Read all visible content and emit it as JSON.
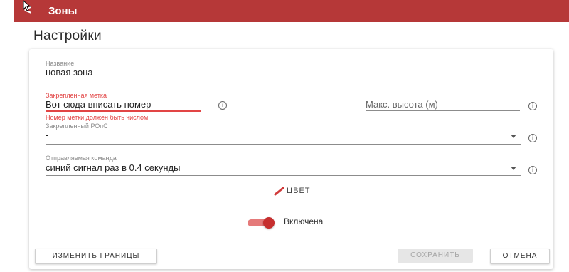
{
  "appbar": {
    "title": "Зоны",
    "back_glyph": "<",
    "color": "#b63838"
  },
  "page": {
    "title": "Настройки"
  },
  "form": {
    "name": {
      "label": "Название",
      "value": "новая зона"
    },
    "pinned_tag": {
      "label": "Закрепленная метка",
      "value": "Вот сюда вписать номер",
      "error": "Номер метки должен быть числом"
    },
    "max_height": {
      "placeholder": "Макс. высота (м)"
    },
    "pinned_ponc": {
      "label": "Закрепленный РОпС",
      "value": "-"
    },
    "command": {
      "label": "Отправляемая команда",
      "value": "синий сигнал раз в 0.4 секунды"
    },
    "color_label": "ЦВЕТ",
    "enabled_label": "Включена",
    "enabled": true
  },
  "buttons": {
    "edit_bounds": "ИЗМЕНИТЬ ГРАНИЦЫ",
    "save": "СОХРАНИТЬ",
    "cancel": "ОТМЕНА"
  },
  "icons": {
    "back": "arrow-back-icon",
    "info": "info-icon",
    "dropdown": "chevron-down-icon",
    "color": "brush-icon"
  },
  "colors": {
    "accent": "#c62f2f",
    "error": "#e24545"
  }
}
